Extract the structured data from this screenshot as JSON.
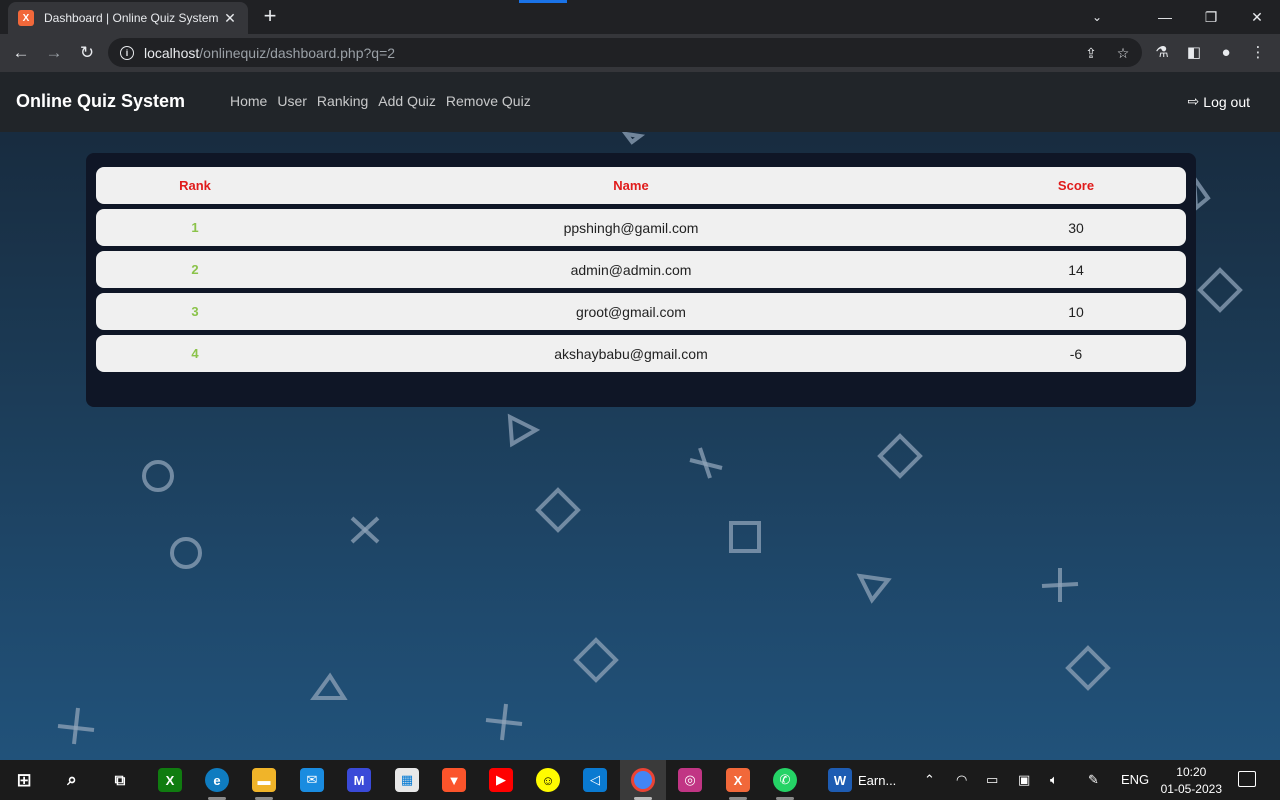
{
  "browser": {
    "tab_title": "Dashboard | Online Quiz System",
    "favicon_text": "X",
    "url_host": "localhost",
    "url_path": "/onlinequiz/dashboard.php?q=2"
  },
  "navbar": {
    "brand": "Online Quiz System",
    "links": [
      "Home",
      "User",
      "Ranking",
      "Add Quiz",
      "Remove Quiz"
    ],
    "logout_label": "Log out"
  },
  "ranking": {
    "headers": {
      "rank": "Rank",
      "name": "Name",
      "score": "Score"
    },
    "rows": [
      {
        "rank": "1",
        "name": "ppshingh@gamil.com",
        "score": "30"
      },
      {
        "rank": "2",
        "name": "admin@admin.com",
        "score": "14"
      },
      {
        "rank": "3",
        "name": "groot@gmail.com",
        "score": "10"
      },
      {
        "rank": "4",
        "name": "akshaybabu@gmail.com",
        "score": "-6"
      }
    ]
  },
  "taskbar": {
    "word_app_label": "Earn...",
    "language": "ENG",
    "time": "10:20",
    "date": "01-05-2023"
  },
  "colors": {
    "header_text": "#e01b1b",
    "rank_text": "#8bc34a",
    "panel_bg": "#0f1626",
    "navbar_bg": "#212529"
  }
}
